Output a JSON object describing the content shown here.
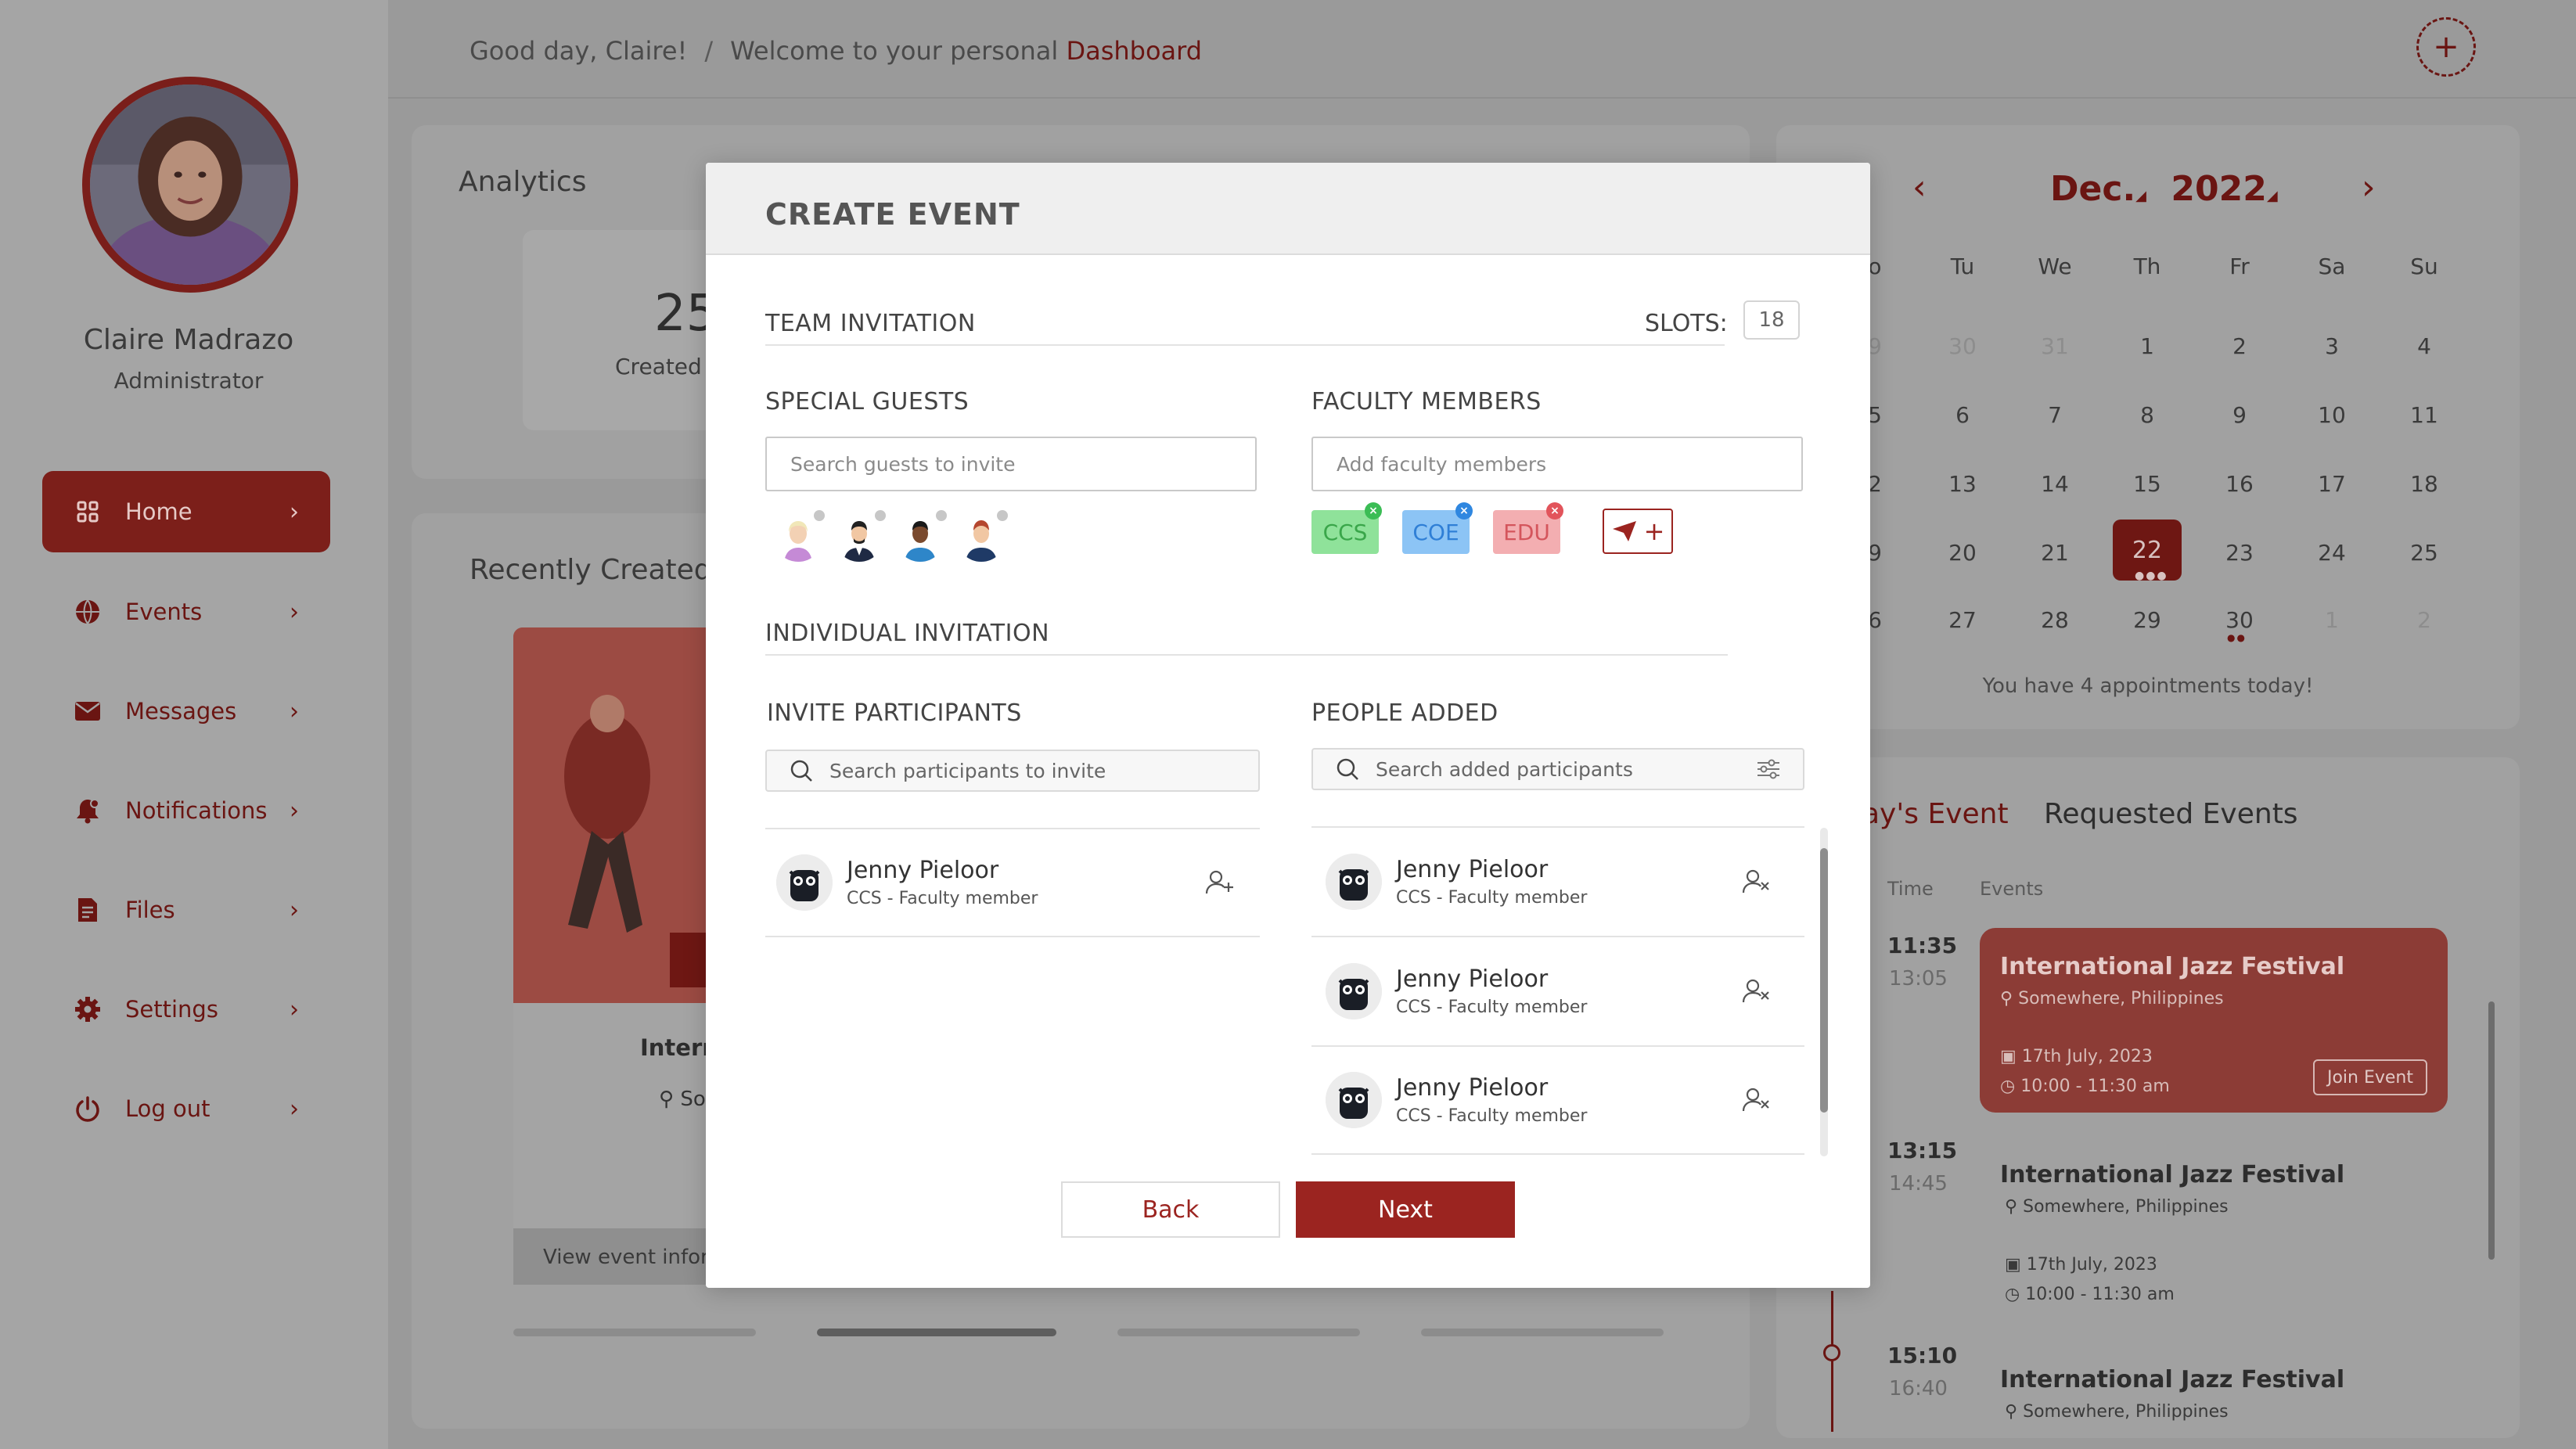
{
  "user": {
    "name": "Claire Madrazo",
    "role": "Administrator"
  },
  "nav": [
    {
      "label": "Home",
      "icon": "grid-icon",
      "active": true
    },
    {
      "label": "Events",
      "icon": "globe-icon"
    },
    {
      "label": "Messages",
      "icon": "mail-icon"
    },
    {
      "label": "Notifications",
      "icon": "bell-icon"
    },
    {
      "label": "Files",
      "icon": "file-icon"
    },
    {
      "label": "Settings",
      "icon": "gear-icon"
    },
    {
      "label": "Log out",
      "icon": "power-icon"
    }
  ],
  "header": {
    "greeting": "Good day, Claire!",
    "separator": "/",
    "welcome": "Welcome to your personal",
    "highlight": "Dashboard"
  },
  "analytics": {
    "title": "Analytics",
    "stat_value": "25",
    "stat_label": "Created"
  },
  "recent": {
    "title": "Recently Created",
    "event_title": "Intern",
    "event_loc": "So",
    "view_info": "View event inform"
  },
  "calendar": {
    "month": "Dec.",
    "year": "2022",
    "dow": [
      "o",
      "Tu",
      "We",
      "Th",
      "Fr",
      "Sa",
      "Su"
    ],
    "weeks": [
      [
        "9",
        "30",
        "31",
        "1",
        "2",
        "3",
        "4"
      ],
      [
        "5",
        "6",
        "7",
        "8",
        "9",
        "10",
        "11"
      ],
      [
        "2",
        "13",
        "14",
        "15",
        "16",
        "17",
        "18"
      ],
      [
        "9",
        "20",
        "21",
        "22",
        "23",
        "24",
        "25"
      ],
      [
        "6",
        "27",
        "28",
        "29",
        "30",
        "1",
        "2"
      ]
    ],
    "appointments": "You have 4 appointments today!"
  },
  "events_panel": {
    "tab_today": "ay's Event",
    "tab_requested": "Requested Events",
    "col_time": "Time",
    "col_events": "Events",
    "items": [
      {
        "start": "11:35",
        "end": "13:05",
        "name": "International Jazz Festival",
        "location": "Somewhere, Philippines",
        "date": "17th July, 2023",
        "time": "10:00 - 11:30 am",
        "action": "Join Event"
      },
      {
        "start": "13:15",
        "end": "14:45",
        "name": "International Jazz Festival",
        "location": "Somewhere, Philippines",
        "date": "17th July, 2023",
        "time": "10:00 - 11:30 am"
      },
      {
        "start": "15:10",
        "end": "16:40",
        "name": "International Jazz Festival",
        "location": "Somewhere, Philippines"
      }
    ]
  },
  "modal": {
    "title": "CREATE EVENT",
    "team_invitation": "TEAM INVITATION",
    "slots_label": "SLOTS:",
    "slots_value": "18",
    "special_guests": "SPECIAL GUESTS",
    "guests_placeholder": "Search guests to invite",
    "faculty_members": "FACULTY MEMBERS",
    "faculty_placeholder": "Add faculty members",
    "tags": [
      {
        "label": "CCS",
        "bg": "#8fe29a",
        "fg": "#3aa64a",
        "x": "#3bbd55"
      },
      {
        "label": "COE",
        "bg": "#8cc4f5",
        "fg": "#2f7fd6",
        "x": "#2f87e0"
      },
      {
        "label": "EDU",
        "bg": "#f3aeb1",
        "fg": "#d4555c",
        "x": "#e2545b"
      }
    ],
    "send_plus": "+",
    "individual_invitation": "INDIVIDUAL INVITATION",
    "invite_participants": "INVITE PARTICIPANTS",
    "invite_placeholder": "Search participants to invite",
    "people_added": "PEOPLE ADDED",
    "added_placeholder": "Search added participants",
    "invite_list": [
      {
        "name": "Jenny Pieloor",
        "role": "CCS - Faculty member"
      }
    ],
    "added_list": [
      {
        "name": "Jenny Pieloor",
        "role": "CCS - Faculty member"
      },
      {
        "name": "Jenny Pieloor",
        "role": "CCS - Faculty member"
      },
      {
        "name": "Jenny Pieloor",
        "role": "CCS - Faculty member"
      }
    ],
    "back": "Back",
    "next": "Next"
  },
  "colors": {
    "accent": "#9b2420",
    "overlay_accent": "#6a1512"
  }
}
